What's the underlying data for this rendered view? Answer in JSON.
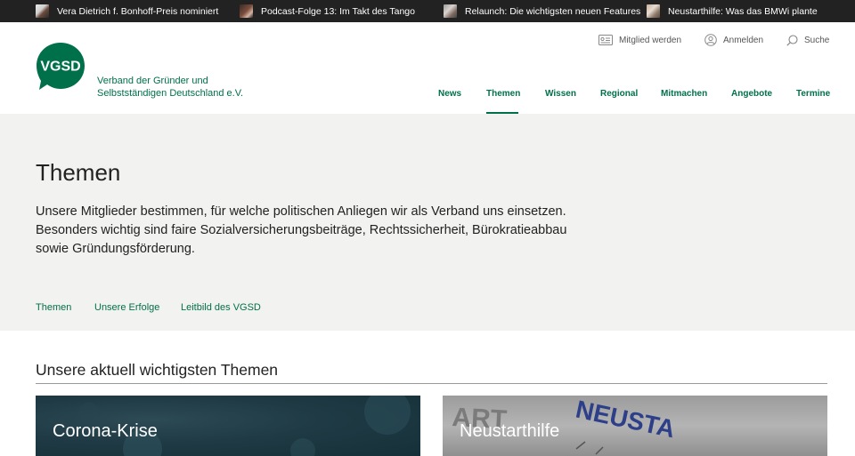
{
  "topbar": {
    "items": [
      {
        "label": "Vera Dietrich f. Bonhoff-Preis nominiert"
      },
      {
        "label": "Podcast-Folge 13: Im Takt des Tango"
      },
      {
        "label": "Relaunch: Die wichtigsten neuen Features"
      },
      {
        "label": "Neustarthilfe: Was das BMWi plante"
      }
    ]
  },
  "header": {
    "logo_text": "VGSD",
    "org_name": "Verband der Gründer und Selbstständigen Deutschland e.V.",
    "utility": [
      {
        "label": "Mitglied werden",
        "icon": "member-card-icon"
      },
      {
        "label": "Anmelden",
        "icon": "user-icon"
      },
      {
        "label": "Suche",
        "icon": "search-icon"
      }
    ],
    "nav": [
      {
        "label": "News"
      },
      {
        "label": "Themen",
        "active": true
      },
      {
        "label": "Wissen"
      },
      {
        "label": "Regional"
      },
      {
        "label": "Mitmachen"
      },
      {
        "label": "Angebote"
      },
      {
        "label": "Termine"
      }
    ]
  },
  "hero": {
    "title": "Themen",
    "text": "Unsere Mitglieder bestimmen, für welche politischen Anliegen wir als Verband uns einsetzen. Besonders wichtig sind faire Sozialversicherungsbeiträge, Rechtssicherheit, Bürokratieabbau sowie Gründungsförderung.",
    "subnav": [
      {
        "label": "Themen"
      },
      {
        "label": "Unsere Erfolge"
      },
      {
        "label": "Leitbild des VGSD"
      }
    ]
  },
  "section": {
    "title": "Unsere aktuell wichtigsten Themen",
    "cards": [
      {
        "title": "Corona-Krise"
      },
      {
        "title": "Neustarthilfe",
        "image_text": "NEUSTA",
        "image_text_2": "ART"
      }
    ]
  },
  "colors": {
    "brand_green": "#00704a",
    "topbar_bg": "#222222",
    "hero_bg": "#f2f2f0"
  }
}
